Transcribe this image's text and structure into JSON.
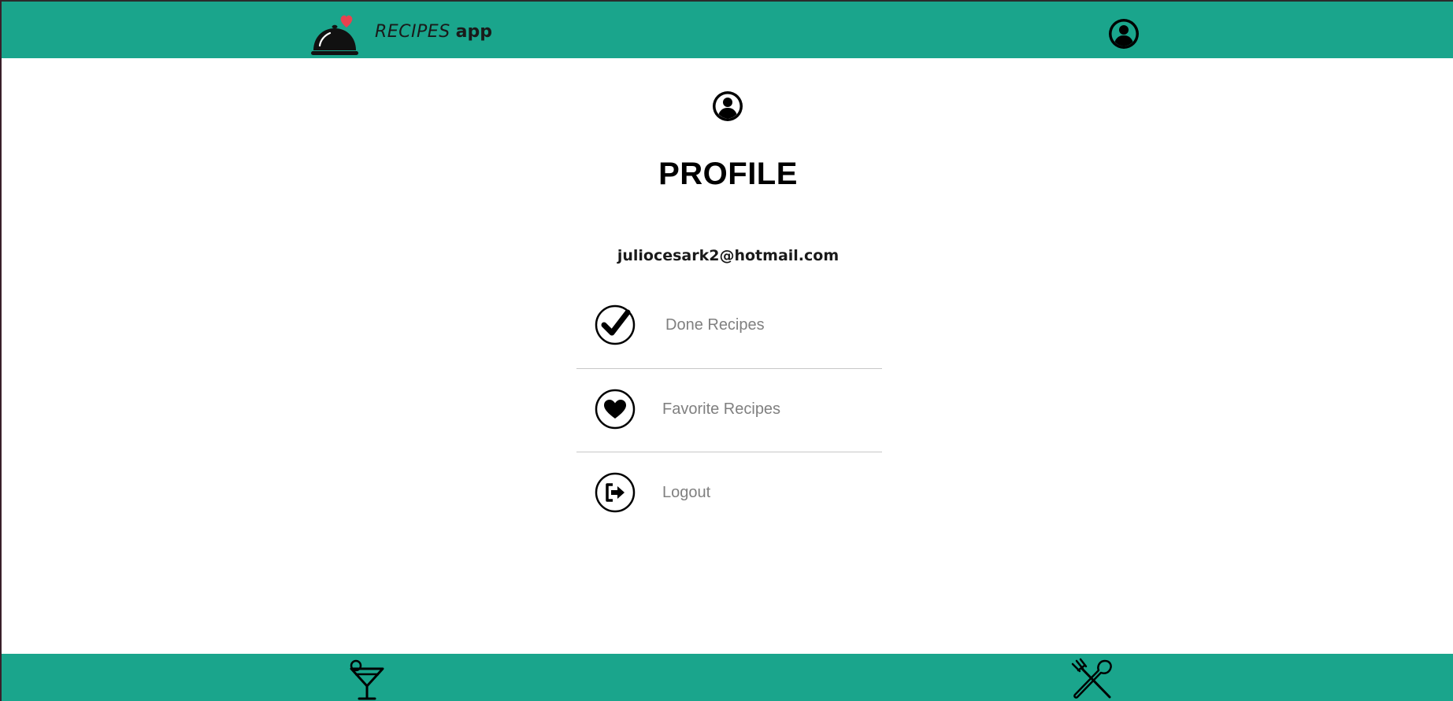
{
  "colors": {
    "header_bg": "#1aa58c",
    "footer_bg": "#1aa58c",
    "label_gray": "#808080",
    "heart_red": "#e8424f"
  },
  "header": {
    "app_name_part1": "RECIPES",
    "app_name_part2": "app",
    "logo_icon": "cloche-heart-icon",
    "profile_icon": "user-circle-icon"
  },
  "main": {
    "avatar_icon": "user-circle-icon",
    "title": "PROFILE",
    "email": "juliocesark2@hotmail.com",
    "menu": [
      {
        "label": "Done Recipes",
        "icon": "check-circle-icon"
      },
      {
        "label": "Favorite Recipes",
        "icon": "heart-circle-icon"
      },
      {
        "label": "Logout",
        "icon": "logout-circle-icon"
      }
    ]
  },
  "footer": {
    "drinks_icon": "cocktail-icon",
    "meals_icon": "fork-spoon-icon"
  }
}
